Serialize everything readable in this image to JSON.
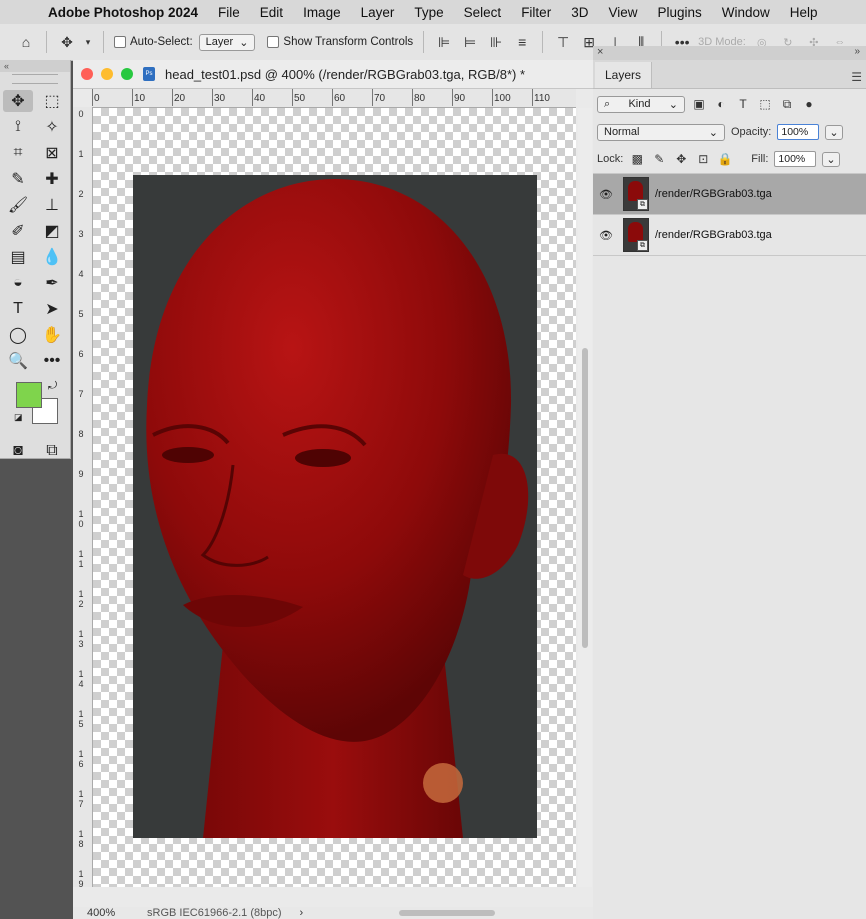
{
  "menubar": {
    "app": "Adobe Photoshop 2024",
    "items": [
      "File",
      "Edit",
      "Image",
      "Layer",
      "Type",
      "Select",
      "Filter",
      "3D",
      "View",
      "Plugins",
      "Window",
      "Help"
    ]
  },
  "options_bar": {
    "auto_select_label": "Auto-Select:",
    "auto_select_value": "Layer",
    "show_transform_label": "Show Transform Controls",
    "mode_3d_label": "3D Mode:"
  },
  "document": {
    "title": "head_test01.psd @ 400% (/render/RGBGrab03.tga, RGB/8*) *",
    "ps_badge": "Ps",
    "h_ruler": [
      "0",
      "10",
      "20",
      "30",
      "40",
      "50",
      "60",
      "70",
      "80",
      "90",
      "100",
      "110"
    ],
    "v_ruler": [
      "0",
      "1",
      "2",
      "3",
      "4",
      "5",
      "6",
      "7",
      "8",
      "9",
      "10",
      "11",
      "12",
      "13",
      "14",
      "15",
      "16",
      "17",
      "18",
      "19"
    ],
    "zoom": "400%",
    "color_profile": "sRGB IEC61966-2.1 (8bpc)",
    "more": "›"
  },
  "tools": {
    "foreground_color": "#7fd44c",
    "background_color": "#ffffff"
  },
  "layers_panel": {
    "tab": "Layers",
    "filter_label": "Kind",
    "blend_mode": "Normal",
    "opacity_label": "Opacity:",
    "opacity_value": "100%",
    "lock_label": "Lock:",
    "fill_label": "Fill:",
    "fill_value": "100%",
    "layers": [
      {
        "name": "/render/RGBGrab03.tga",
        "selected": true
      },
      {
        "name": "/render/RGBGrab03.tga",
        "selected": false
      }
    ]
  }
}
